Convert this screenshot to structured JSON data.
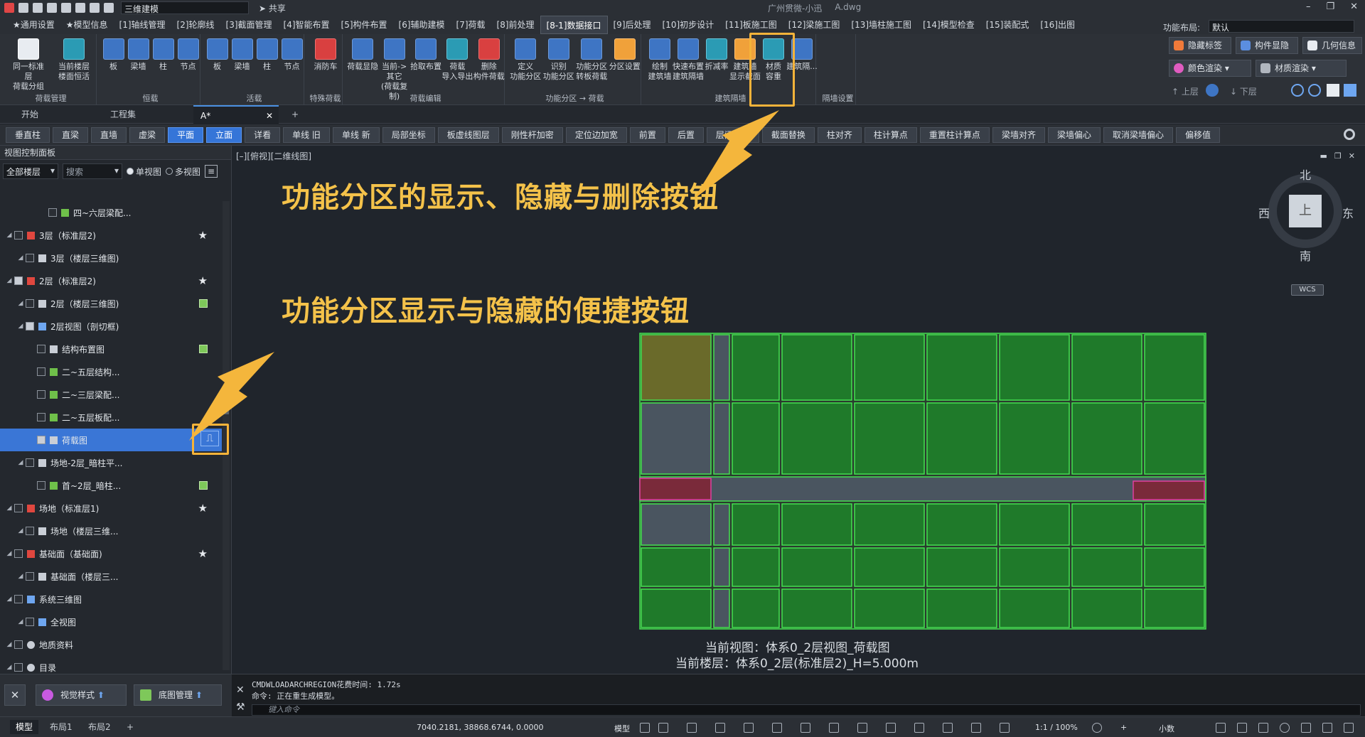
{
  "titlebar": {
    "workspace": "三维建模",
    "share": "共享",
    "app_name": "广州贯微-小迅",
    "file_name": "A.dwg",
    "win_minimize": "–",
    "win_restore": "❐",
    "win_close": "✕"
  },
  "menubar": {
    "items": [
      "★通用设置",
      "★模型信息",
      "[1]轴线管理",
      "[2]轮廓线",
      "[3]截面管理",
      "[4]智能布置",
      "[5]构件布置",
      "[6]辅助建模",
      "[7]荷载",
      "[8]前处理",
      "[8-1]数据接口",
      "[9]后处理",
      "[10]初步设计",
      "[11]板施工图",
      "[12]梁施工图",
      "[13]墙柱施工图",
      "[14]模型检查",
      "[15]装配式",
      "[16]出图"
    ],
    "layout_label": "功能布局:",
    "layout_value": "默认"
  },
  "ribbon": {
    "groups": [
      {
        "label": "荷载管理",
        "buttons": [
          "同一标准层\n荷载分组",
          "当前楼层\n楼面恒活"
        ]
      },
      {
        "label": "恒载",
        "buttons": [
          "板",
          "梁墙",
          "柱",
          "节点"
        ]
      },
      {
        "label": "活载",
        "buttons": [
          "板",
          "梁墙",
          "柱",
          "节点"
        ]
      },
      {
        "label": "特殊荷载",
        "buttons": [
          "消防车"
        ]
      },
      {
        "label": "荷载编辑",
        "buttons": [
          "荷载显隐",
          "当前->其它\n(荷载复制)",
          "拾取布置",
          "荷载\n导入导出",
          "删除\n构件荷载"
        ]
      },
      {
        "label": "功能分区 → 荷载",
        "buttons": [
          "定义\n功能分区",
          "识别\n功能分区",
          "功能分区\n转板荷载",
          "分区设置"
        ]
      },
      {
        "label": "建筑隔墙",
        "buttons": [
          "绘制\n建筑墙",
          "快速布置\n建筑隔墙",
          "折减率",
          "建筑墙\n显示截面",
          "材质\n容重",
          "建筑隔..."
        ]
      },
      {
        "label": "隔墙设置",
        "buttons": []
      }
    ],
    "right": {
      "hide_label": "隐藏标签",
      "component_show": "构件显隐",
      "geometry_info": "几何信息",
      "color_render": "颜色渲染",
      "material_render": "材质渲染",
      "up_floor": "上层",
      "down_floor": "下层"
    }
  },
  "tabs": {
    "start": "开始",
    "project": "工程集",
    "active": "A*",
    "close": "✕",
    "add": "+"
  },
  "toolbar2": {
    "buttons": [
      "垂直柱",
      "直梁",
      "直墙",
      "虚梁",
      "平面",
      "立面",
      "详看",
      "单线 旧",
      "单线 新",
      "局部坐标",
      "板虚线图层",
      "刚性杆加密",
      "定位边加宽",
      "前置",
      "后置",
      "层间复制",
      "截面替换",
      "柱对齐",
      "柱计算点",
      "重置柱计算点",
      "梁墙对齐",
      "梁墙偏心",
      "取消梁墙偏心",
      "偏移值"
    ]
  },
  "panel": {
    "title": "视图控制面板",
    "floor_select": "全部楼层",
    "search_placeholder": "搜索",
    "single_view": "单视图",
    "multi_view": "多视图",
    "tree": [
      {
        "label": "四~六层梁配...",
        "level": 3,
        "icon": "green"
      },
      {
        "label": "3层（标准层2)",
        "level": 0,
        "icon": "red",
        "star": true
      },
      {
        "label": "3层（楼层三维图)",
        "level": 1,
        "icon": "grid"
      },
      {
        "label": "2层（标准层2)",
        "level": 0,
        "icon": "red",
        "star": true,
        "checked": true
      },
      {
        "label": "2层（楼层三维图)",
        "level": 1,
        "icon": "grid",
        "side": true
      },
      {
        "label": "2层视图（剖切框)",
        "level": 1,
        "icon": "blue",
        "checked": true
      },
      {
        "label": "结构布置图",
        "level": 2,
        "icon": "grid",
        "side": true
      },
      {
        "label": "二~五层结构...",
        "level": 2,
        "icon": "green"
      },
      {
        "label": "二~三层梁配...",
        "level": 2,
        "icon": "green"
      },
      {
        "label": "二~五层板配...",
        "level": 2,
        "icon": "green"
      },
      {
        "label": "荷载图",
        "level": 2,
        "icon": "dots",
        "checked": true,
        "selected": true
      },
      {
        "label": "场地-2层_暗柱平...",
        "level": 1,
        "icon": "grid"
      },
      {
        "label": "首~2层_暗柱...",
        "level": 2,
        "icon": "green",
        "side": true
      },
      {
        "label": "场地（标准层1)",
        "level": 0,
        "icon": "red",
        "star": true
      },
      {
        "label": "场地（楼层三维...",
        "level": 1,
        "icon": "grid"
      },
      {
        "label": "基础面（基础面)",
        "level": 0,
        "icon": "red",
        "star": true
      },
      {
        "label": "基础面（楼层三...",
        "level": 1,
        "icon": "grid"
      },
      {
        "label": "系统三维图",
        "level": 0,
        "icon": "blue"
      },
      {
        "label": "全视图",
        "level": 1,
        "icon": "blue"
      },
      {
        "label": "地质资料",
        "level": 0,
        "icon": "circle"
      },
      {
        "label": "目录",
        "level": 0,
        "icon": "circle"
      }
    ],
    "footer_style": "视觉样式",
    "footer_base": "底图管理"
  },
  "canvas": {
    "view_label": "[–][俯视][二维线图]",
    "annotation_1": "功能分区的显示、隐藏与删除按钮",
    "annotation_2": "功能分区显示与隐藏的便捷按钮",
    "compass": {
      "north": "北",
      "south": "南",
      "east": "东",
      "west": "西",
      "center": "上"
    },
    "wcs": "WCS",
    "current_view": "当前视图：体系0_2层视图_荷载图",
    "current_floor": "当前楼层：体系0_2层(标准层2)_H=5.000m"
  },
  "command": {
    "line1": "CMDWLOADARCHREGION花费时间: 1.72s",
    "line2": "命令: 正在重生成模型。",
    "placeholder": "键入命令"
  },
  "statusbar": {
    "tabs": [
      "模型",
      "布局1",
      "布局2"
    ],
    "add": "+",
    "coords": "7040.2181, 38868.6744, 0.0000",
    "model": "模型",
    "scale": "1:1 / 100%",
    "precision": "小数"
  },
  "colors": {
    "accent": "#3575d8",
    "annotation": "#f4c24a",
    "zone_green": "#1f7a2a",
    "grid_line": "#44e050"
  }
}
